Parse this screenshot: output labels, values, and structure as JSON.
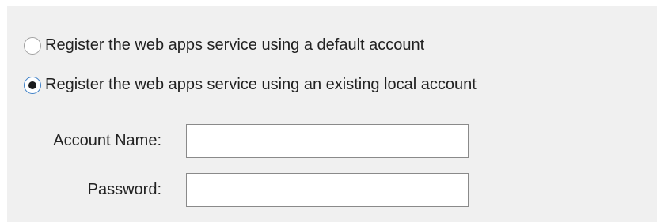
{
  "options": [
    {
      "label": "Register the web apps service using a default account",
      "selected": false
    },
    {
      "label": "Register the web apps service using an existing local account",
      "selected": true
    }
  ],
  "fields": {
    "account_name": {
      "label": "Account Name:",
      "value": ""
    },
    "password": {
      "label": "Password:",
      "value": ""
    }
  },
  "colors": {
    "panel_background": "#f0f0f0",
    "radio_focus_border": "#3c7fc7"
  }
}
